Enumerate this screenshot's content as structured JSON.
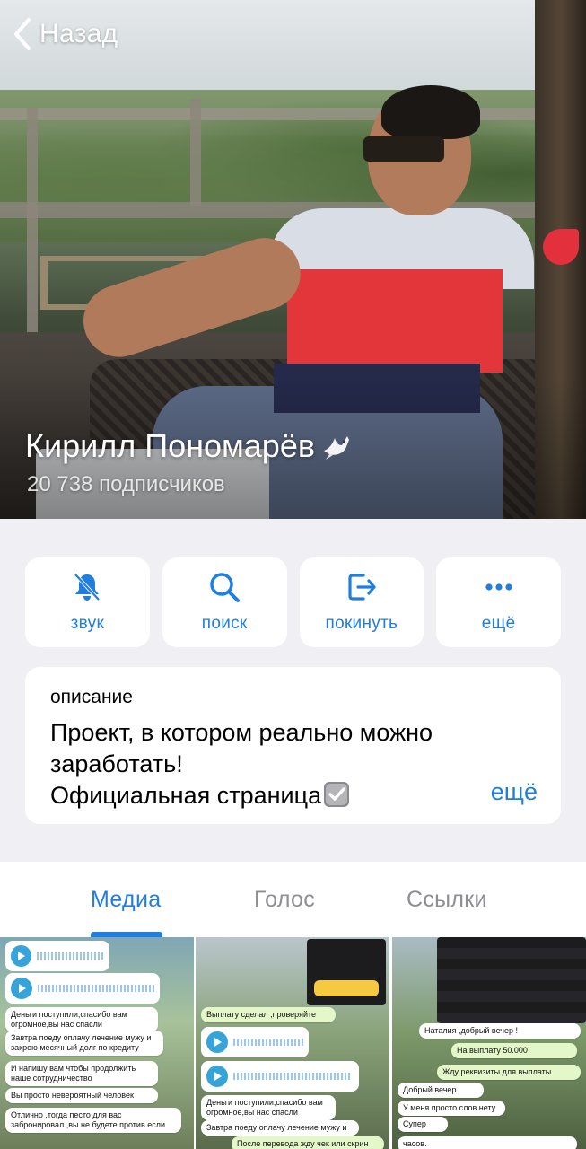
{
  "nav": {
    "back_label": "Назад"
  },
  "channel": {
    "name": "Кирилл Пономарёв",
    "name_emoji_icon": "dove-icon",
    "subscribers": "20 738 подписчиков"
  },
  "actions": [
    {
      "label": "звук",
      "icon": "bell-muted-icon"
    },
    {
      "label": "поиск",
      "icon": "search-icon"
    },
    {
      "label": "покинуть",
      "icon": "leave-icon"
    },
    {
      "label": "ещё",
      "icon": "more-icon"
    }
  ],
  "description": {
    "caption": "описание",
    "line1": "Проект, в котором реально можно",
    "line2": "заработать!",
    "line3": "Официальная страница",
    "more_label": "ещё"
  },
  "tabs": [
    {
      "label": "Медиа",
      "active": true
    },
    {
      "label": "Голос",
      "active": false
    },
    {
      "label": "Ссылки",
      "active": false
    }
  ],
  "media": {
    "thumb1": {
      "messages": [
        "Деньги поступили,спасибо вам огромное,вы нас спасли",
        "Завтра поеду оплачу лечение мужу и закрою месячный долг по кредиту",
        "И напишу вам чтобы продолжить наше сотрудничество",
        "Вы просто невероятный человек",
        "Отлично ,тогда песто для вас забронировал ,вы не будете против если"
      ]
    },
    "thumb2": {
      "messages": [
        "Выплату сделал ,проверяйте",
        "Деньги поступили,спасибо вам огромное,вы нас спасли",
        "Завтра поеду оплачу лечение мужу и",
        "После перевода жду чек или скрин"
      ]
    },
    "thumb3": {
      "messages": [
        "Наталия ,добрый вечер !",
        "На выплату 50.000",
        "Жду реквизиты для выплаты",
        "Добрый вечер",
        "У меня просто слов нету",
        "Супер",
        "часов."
      ]
    }
  },
  "colors": {
    "accent": "#1f7ee0",
    "background": "#efeff4",
    "card": "#ffffff"
  }
}
